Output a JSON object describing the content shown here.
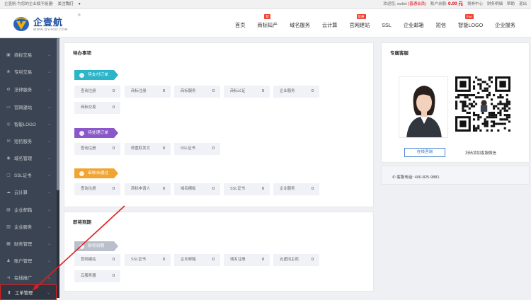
{
  "topbar": {
    "welcome": "企壹航-为您的企业赋予能量!",
    "follow": "关注我们",
    "user_prefix": "欢迎您,",
    "username": "wuliei",
    "member": "(普通会员)",
    "balance_label": "账户余额:",
    "balance": "0.00 元",
    "links": [
      "领券中心",
      "财务明细",
      "帮助",
      "退出"
    ]
  },
  "brand": {
    "name_cn": "企壹航",
    "name_en": "WWW.QYHGO.COM",
    "mark": "®"
  },
  "nav": [
    {
      "label": "首页",
      "badge": ""
    },
    {
      "label": "商标知产",
      "badge": "荐"
    },
    {
      "label": "域名服务",
      "badge": ""
    },
    {
      "label": "云计算",
      "badge": ""
    },
    {
      "label": "官网建站",
      "badge": "优惠"
    },
    {
      "label": "SSL",
      "badge": ""
    },
    {
      "label": "企业邮箱",
      "badge": ""
    },
    {
      "label": "短信",
      "badge": ""
    },
    {
      "label": "智能LOGO",
      "badge": "free"
    },
    {
      "label": "企业服务",
      "badge": ""
    }
  ],
  "sidebar": [
    {
      "label": "商标交易",
      "icon": "▣"
    },
    {
      "label": "专利交易",
      "icon": "❀"
    },
    {
      "label": "法律服务",
      "icon": "⚙"
    },
    {
      "label": "官网建站",
      "icon": "▭"
    },
    {
      "label": "智能LOGO",
      "icon": "◎"
    },
    {
      "label": "短信服务",
      "icon": "✉"
    },
    {
      "label": "域名管理",
      "icon": "◉"
    },
    {
      "label": "SSL证书",
      "icon": "▢"
    },
    {
      "label": "云计算",
      "icon": "☁"
    },
    {
      "label": "企业邮箱",
      "icon": "▤"
    },
    {
      "label": "企业服务",
      "icon": "▥"
    },
    {
      "label": "财务管理",
      "icon": "▦"
    },
    {
      "label": "账户管理",
      "icon": "♟"
    },
    {
      "label": "在线推广",
      "icon": "⊲"
    },
    {
      "label": "工单管理",
      "icon": "▮"
    }
  ],
  "pending": {
    "title": "待办事项",
    "groups": [
      {
        "tag": "待支付订单",
        "color": "#2ab5c8",
        "rows": [
          [
            {
              "label": "查询注册",
              "count": "0"
            },
            {
              "label": "商标注册",
              "count": "0"
            },
            {
              "label": "商标服务",
              "count": "0"
            },
            {
              "label": "商标公证",
              "count": "0"
            },
            {
              "label": "企业服务",
              "count": "0"
            }
          ],
          [
            {
              "label": "商标交易",
              "count": "0"
            }
          ]
        ]
      },
      {
        "tag": "待处理订单",
        "color": "#8a58c8",
        "rows": [
          [
            {
              "label": "查询注册",
              "count": "0"
            },
            {
              "label": "修重取发文",
              "count": "0"
            },
            {
              "label": "SSL证书",
              "count": "0"
            }
          ]
        ]
      },
      {
        "tag": "审核未通过",
        "color": "#f1a531",
        "rows": [
          [
            {
              "label": "查询注册",
              "count": "0"
            },
            {
              "label": "商标申请人",
              "count": "0"
            },
            {
              "label": "域名模板",
              "count": "0"
            },
            {
              "label": "SSL证书",
              "count": "0"
            },
            {
              "label": "企业服务",
              "count": "0"
            }
          ]
        ]
      }
    ]
  },
  "expiring": {
    "title": "即将到期",
    "tag": "即将到期",
    "color": "#b9c0cc",
    "rows": [
      [
        {
          "label": "官网建站",
          "count": "0"
        },
        {
          "label": "SSL证书",
          "count": "0"
        },
        {
          "label": "企业邮箱",
          "count": "0"
        },
        {
          "label": "域名注册",
          "count": "0"
        },
        {
          "label": "云虚拟主机",
          "count": "0"
        }
      ],
      [
        {
          "label": "云服务器",
          "count": "0"
        }
      ]
    ]
  },
  "service": {
    "title": "专属客服",
    "button": "在线咨询",
    "qr_text": "扫码添加客服微信",
    "hotline_label": "客服电话:",
    "hotline": "400-825-9881"
  },
  "colors": {
    "accent": "#2f6fc4",
    "sidebar_bg": "#3b4452",
    "highlight": "#e21d1d"
  }
}
